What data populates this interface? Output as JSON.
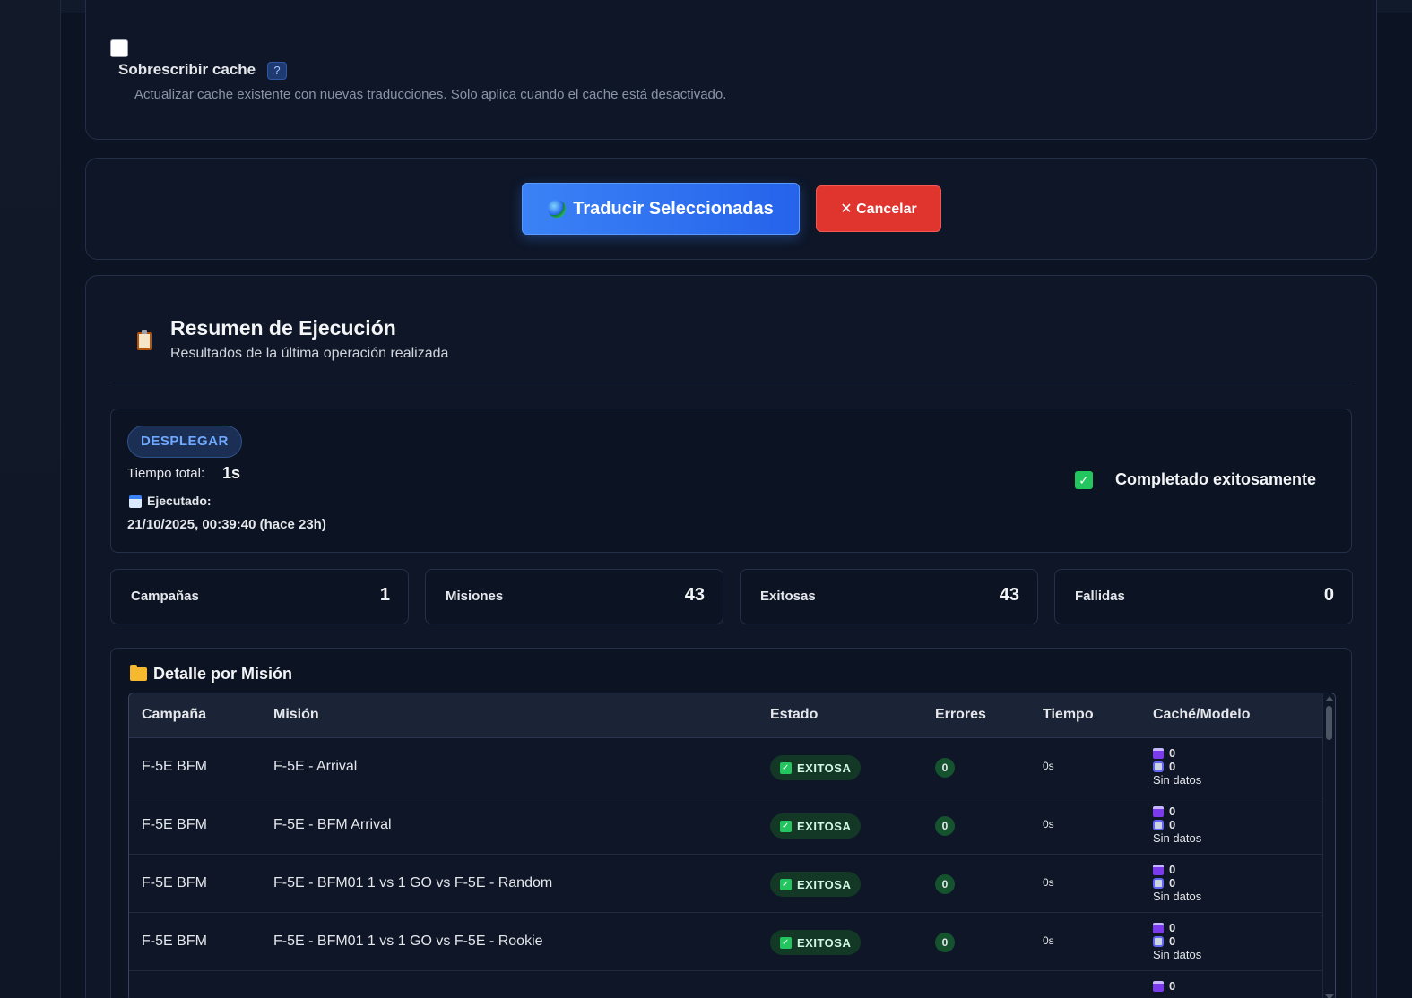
{
  "options": {
    "overwrite_label": "Sobrescribir cache",
    "help": "?",
    "overwrite_desc": "Actualizar cache existente con nuevas traducciones. Solo aplica cuando el cache está desactivado.",
    "overwrite_checked": false
  },
  "actions": {
    "translate_label": "Traducir Seleccionadas",
    "cancel_label": "✕ Cancelar"
  },
  "summary": {
    "title": "Resumen de Ejecución",
    "subtitle": "Resultados de la última operación realizada",
    "mode": "DESPLEGAR",
    "total_time_label": "Tiempo total:",
    "total_time": "1s",
    "executed_label": "Ejecutado:",
    "executed_at": "21/10/2025, 00:39:40 (hace 23h)",
    "status_text": "Completado exitosamente",
    "colors": {
      "primary": "#3b82f6",
      "danger": "#e0342f",
      "success": "#22c55e"
    }
  },
  "stats": [
    {
      "label": "Campañas",
      "value": "1"
    },
    {
      "label": "Misiones",
      "value": "43"
    },
    {
      "label": "Exitosas",
      "value": "43"
    },
    {
      "label": "Fallidas",
      "value": "0"
    }
  ],
  "detail": {
    "title": "Detalle por Misión",
    "columns": [
      "Campaña",
      "Misión",
      "Estado",
      "Errores",
      "Tiempo",
      "Caché/Modelo"
    ],
    "rows": [
      {
        "campaign": "F-5E BFM",
        "mission": "F-5E - Arrival",
        "status": "EXITOSA",
        "errors": "0",
        "time": "0s",
        "cache": "0",
        "model": "0",
        "note": "Sin datos"
      },
      {
        "campaign": "F-5E BFM",
        "mission": "F-5E - BFM Arrival",
        "status": "EXITOSA",
        "errors": "0",
        "time": "0s",
        "cache": "0",
        "model": "0",
        "note": "Sin datos"
      },
      {
        "campaign": "F-5E BFM",
        "mission": "F-5E - BFM01 1 vs 1 GO vs F-5E - Random",
        "status": "EXITOSA",
        "errors": "0",
        "time": "0s",
        "cache": "0",
        "model": "0",
        "note": "Sin datos"
      },
      {
        "campaign": "F-5E BFM",
        "mission": "F-5E - BFM01 1 vs 1 GO vs F-5E - Rookie",
        "status": "EXITOSA",
        "errors": "0",
        "time": "0s",
        "cache": "0",
        "model": "0",
        "note": "Sin datos"
      },
      {
        "campaign": "",
        "mission": "",
        "status": "",
        "errors": "",
        "time": "",
        "cache": "0",
        "model": "",
        "note": ""
      }
    ]
  }
}
